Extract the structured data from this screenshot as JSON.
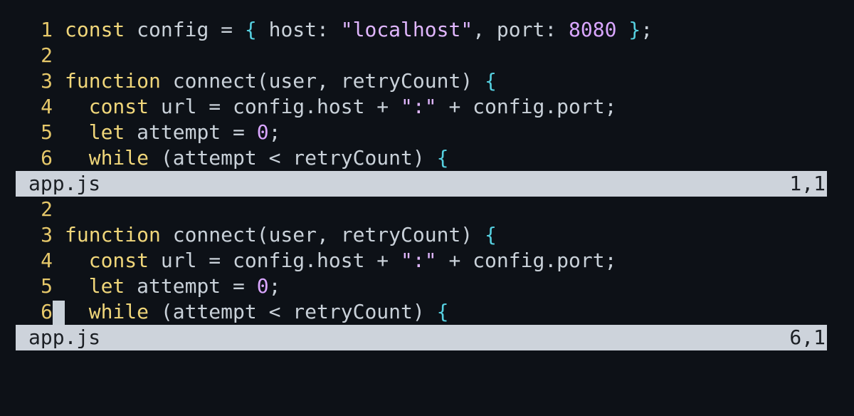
{
  "panes": [
    {
      "lines": [
        {
          "n": "1",
          "tokens": [
            [
              "kw",
              "const"
            ],
            [
              "id",
              " config = "
            ],
            [
              "brace",
              "{"
            ],
            [
              "id",
              " host: "
            ],
            [
              "str",
              "\"localhost\""
            ],
            [
              "id",
              ", port: "
            ],
            [
              "num",
              "8080"
            ],
            [
              "id",
              " "
            ],
            [
              "brace",
              "}"
            ],
            [
              "id",
              ";"
            ]
          ]
        },
        {
          "n": "2",
          "tokens": []
        },
        {
          "n": "3",
          "tokens": [
            [
              "kw",
              "function"
            ],
            [
              "id",
              " connect(user, retryCount) "
            ],
            [
              "brace",
              "{"
            ]
          ]
        },
        {
          "n": "4",
          "tokens": [
            [
              "id",
              "  "
            ],
            [
              "kw",
              "const"
            ],
            [
              "id",
              " url = config.host + "
            ],
            [
              "str",
              "\":\""
            ],
            [
              "id",
              " + config.port;"
            ]
          ]
        },
        {
          "n": "5",
          "tokens": [
            [
              "id",
              "  "
            ],
            [
              "kw",
              "let"
            ],
            [
              "id",
              " attempt = "
            ],
            [
              "num",
              "0"
            ],
            [
              "id",
              ";"
            ]
          ]
        },
        {
          "n": "6",
          "tokens": [
            [
              "id",
              "  "
            ],
            [
              "kw",
              "while"
            ],
            [
              "id",
              " (attempt < retryCount) "
            ],
            [
              "brace",
              "{"
            ]
          ]
        }
      ],
      "status": {
        "file": "app.js",
        "position": "1,1"
      }
    },
    {
      "lines": [
        {
          "n": "2",
          "tokens": []
        },
        {
          "n": "3",
          "tokens": [
            [
              "kw",
              "function"
            ],
            [
              "id",
              " connect(user, retryCount) "
            ],
            [
              "brace",
              "{"
            ]
          ]
        },
        {
          "n": "4",
          "tokens": [
            [
              "id",
              "  "
            ],
            [
              "kw",
              "const"
            ],
            [
              "id",
              " url = config.host + "
            ],
            [
              "str",
              "\":\""
            ],
            [
              "id",
              " + config.port;"
            ]
          ]
        },
        {
          "n": "5",
          "tokens": [
            [
              "id",
              "  "
            ],
            [
              "kw",
              "let"
            ],
            [
              "id",
              " attempt = "
            ],
            [
              "num",
              "0"
            ],
            [
              "id",
              ";"
            ]
          ]
        },
        {
          "n": "6",
          "cursor": true,
          "tokens": [
            [
              "id",
              "  "
            ],
            [
              "kw",
              "while"
            ],
            [
              "id",
              " (attempt < retryCount) "
            ],
            [
              "brace",
              "{"
            ]
          ]
        }
      ],
      "status": {
        "file": "app.js",
        "position": "6,1"
      }
    }
  ],
  "colors": {
    "background": "#0d1117",
    "line_number": "#e6c86a",
    "keyword": "#f0d67a",
    "string": "#e0b6ff",
    "number": "#d9a6ff",
    "brace": "#56d0e0",
    "text": "#c9d1d9",
    "statusbar_bg": "#cdd3db"
  }
}
